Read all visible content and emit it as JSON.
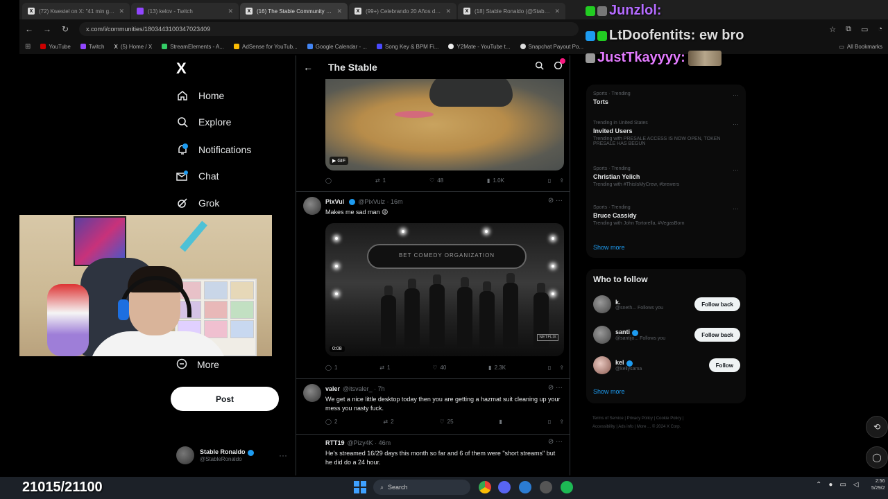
{
  "browser": {
    "tabs": [
      {
        "label": "(72) Kwestel on X: \"41 min glaz...",
        "icon": "x-icon",
        "active": false
      },
      {
        "label": "(13) kelov - Twitch",
        "icon": "twitch-icon",
        "active": false
      },
      {
        "label": "(16) The Stable Community / X",
        "icon": "x-icon",
        "active": true
      },
      {
        "label": "(99+) Celebrando 20 Años de...",
        "icon": "x-icon",
        "active": false
      },
      {
        "label": "(18) Stable Ronaldo (@StableR...",
        "icon": "x-icon",
        "active": false
      }
    ],
    "url": "x.com/i/communities/1803443100347023409",
    "bookmarks": [
      "YouTube",
      "Twitch",
      "(5) Home / X",
      "StreamElements - A...",
      "AdSense for YouTub...",
      "Google Calendar - ...",
      "Song Key & BPM Fi...",
      "Y2Mate - YouTube t...",
      "Snapchat Payout Po...",
      "All Bookmarks"
    ]
  },
  "nav": {
    "logo": "X",
    "items": [
      {
        "label": "Home",
        "icon": "home-icon"
      },
      {
        "label": "Explore",
        "icon": "search-icon"
      },
      {
        "label": "Notifications",
        "icon": "bell-icon"
      },
      {
        "label": "Chat",
        "icon": "mail-icon"
      },
      {
        "label": "Grok",
        "icon": "grok-icon"
      }
    ],
    "more_label": "More",
    "post_label": "Post",
    "profile": {
      "name": "Stable Ronaldo",
      "handle": "@StableRonaldo"
    }
  },
  "community": {
    "title": "The Stable",
    "tweet1": {
      "badge": "GIF",
      "replies": "",
      "retweets": "1",
      "likes": "48",
      "views": "1.0K"
    },
    "tweet2": {
      "name": "PixVul",
      "handle": "@PixVulz · 16m",
      "text": "Makes me sad man 😩",
      "banner": "BET COMEDY ORGANIZATION",
      "video_time": "0:08",
      "logo": "NETFLIX",
      "replies": "1",
      "retweets": "1",
      "likes": "40",
      "views": "2.3K"
    },
    "tweet3": {
      "name": "valer",
      "handle": "@itsvaler_ · 7h",
      "text": "We get a nice little desktop today then you are getting a hazmat suit cleaning up your mess you nasty fuck.",
      "replies": "2",
      "retweets": "2",
      "likes": "25",
      "views": ""
    },
    "tweet4": {
      "name": "RTT19",
      "handle": "@Pizy4K · 46m",
      "text": "He's streamed 16/29 days this month so far and 6 of them were \"short streams\" but he did do a 24 hour."
    }
  },
  "trends": {
    "items": [
      {
        "category": "Sports · Trending",
        "name": "Torts",
        "sub": ""
      },
      {
        "category": "Trending in United States",
        "name": "Invited Users",
        "sub": "Trending with PRESALE ACCESS IS NOW OPEN, TOKEN PRESALE HAS BEGUN"
      },
      {
        "category": "Sports · Trending",
        "name": "Christian Yelich",
        "sub": "Trending with #ThisIsMyCrew, #brewers"
      },
      {
        "category": "Sports · Trending",
        "name": "Bruce Cassidy",
        "sub": "Trending with John Tortorella, #VegasBorn"
      }
    ],
    "show_more": "Show more"
  },
  "who_to_follow": {
    "title": "Who to follow",
    "accounts": [
      {
        "name": "k.",
        "handle": "@sneth...",
        "follows_you": "Follows you",
        "button": "Follow back"
      },
      {
        "name": "santi",
        "handle": "@santijo...",
        "follows_you": "Follows you",
        "button": "Follow back"
      },
      {
        "name": "kel",
        "handle": "@kellysama",
        "follows_you": "",
        "button": "Follow"
      }
    ],
    "show_more": "Show more"
  },
  "footer": {
    "links": [
      "Terms of Service",
      "Privacy Policy",
      "Cookie Policy",
      "Accessibility",
      "Ads info",
      "More ...",
      "© 2024 X Corp."
    ]
  },
  "chat_overlay": [
    {
      "user": "Junzlol",
      "message": ""
    },
    {
      "user": "LtDoofentits",
      "message": "ew bro"
    },
    {
      "user": "JustTkayyyy",
      "message": ""
    }
  ],
  "stream": {
    "counter": "21015/21100"
  },
  "taskbar": {
    "search_placeholder": "Search",
    "time": "2:56",
    "date": "5/29/2"
  }
}
